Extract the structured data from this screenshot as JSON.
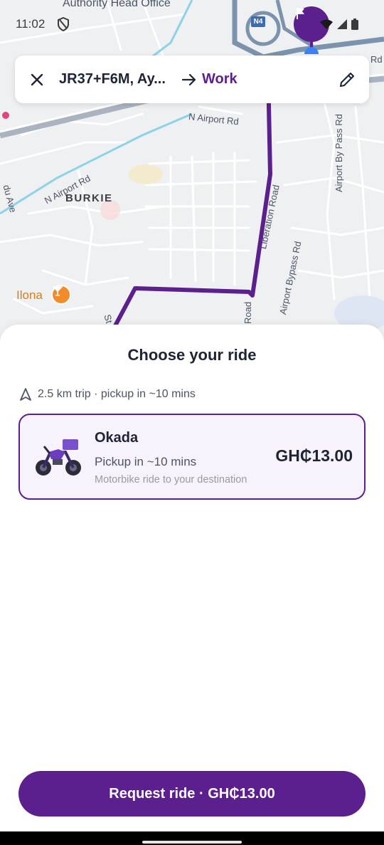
{
  "status_bar": {
    "time": "11:02"
  },
  "map": {
    "labels": {
      "authority": "Authority Head Office",
      "n4": "N4",
      "rd_top": "Rd",
      "n_airport_rd_1": "N Airport Rd",
      "n_airport_rd_2": "N Airport Rd",
      "burkie": "BURKIE",
      "airport_by_pass_rd": "Airport By Pass Rd",
      "liberation_road": "Liberation Road",
      "airport_bypass_rd": "Airport Bypass Rd",
      "road": "Road",
      "st": "St",
      "du_ave": "du Ave",
      "ilona": "Ilona"
    },
    "route_color": "#5b1f8e"
  },
  "route_card": {
    "origin": "JR37+F6M, Ay...",
    "destination": "Work"
  },
  "sheet": {
    "title": "Choose your ride",
    "trip_info": "2.5 km trip · pickup in ~10 mins",
    "ride_option": {
      "name": "Okada",
      "pickup": "Pickup in ~10 mins",
      "description": "Motorbike ride to your destination",
      "price": "GH₵13.00"
    },
    "request_button": "Request ride · GH₵13.00"
  },
  "colors": {
    "accent": "#5b1f8e",
    "selected_bg": "#f8f2fd"
  }
}
